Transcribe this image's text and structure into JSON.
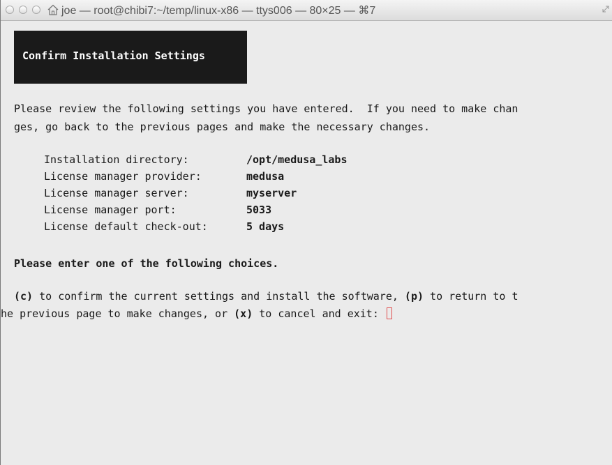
{
  "window": {
    "title": "joe — root@chibi7:~/temp/linux-x86 — ttys006 — 80×25 — ⌘7"
  },
  "terminal": {
    "header": "Confirm Installation Settings",
    "intro_line1": "Please review the following settings you have entered.  If you need to make chan",
    "intro_line2": "ges, go back to the previous pages and make the necessary changes.",
    "settings": [
      {
        "label": "Installation directory:",
        "value": "/opt/medusa_labs"
      },
      {
        "label": "License manager provider:",
        "value": "medusa"
      },
      {
        "label": "License manager server:",
        "value": "myserver"
      },
      {
        "label": "License manager port:",
        "value": "5033"
      },
      {
        "label": "License default check-out:",
        "value": "5 days"
      }
    ],
    "choices_heading": "Please enter one of the following choices.",
    "prompt": {
      "opt_c": "(c)",
      "text1": " to confirm the current settings and install the software, ",
      "opt_p": "(p)",
      "text2": " to return to t",
      "text3": "he previous page to make changes, or ",
      "opt_x": "(x)",
      "text4": " to cancel and exit: "
    }
  },
  "icons": {
    "home": "home-icon",
    "fullscreen": "fullscreen-icon",
    "cursor": "text-cursor"
  },
  "colors": {
    "terminal_bg": "#ebebeb",
    "terminal_fg": "#1a1a1a",
    "header_bg": "#1a1a1a",
    "cursor": "#e05050"
  }
}
